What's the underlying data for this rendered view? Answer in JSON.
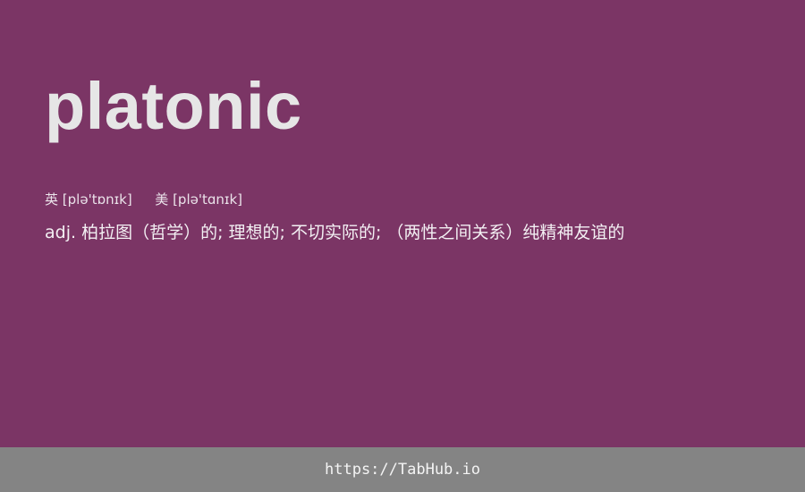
{
  "word": "platonic",
  "phonetics": {
    "uk_label": "英",
    "uk": "[plə'tɒnɪk]",
    "us_label": "美",
    "us": "[plə'tɑnɪk]"
  },
  "definition": {
    "pos": "adj.",
    "text": "柏拉图（哲学）的; 理想的; 不切实际的; （两性之间关系）纯精神友谊的"
  },
  "footer": {
    "link": "https://TabHub.io"
  },
  "colors": {
    "background": "#7b3565",
    "footer_bar": "#848484",
    "text": "#e6e6e6"
  }
}
